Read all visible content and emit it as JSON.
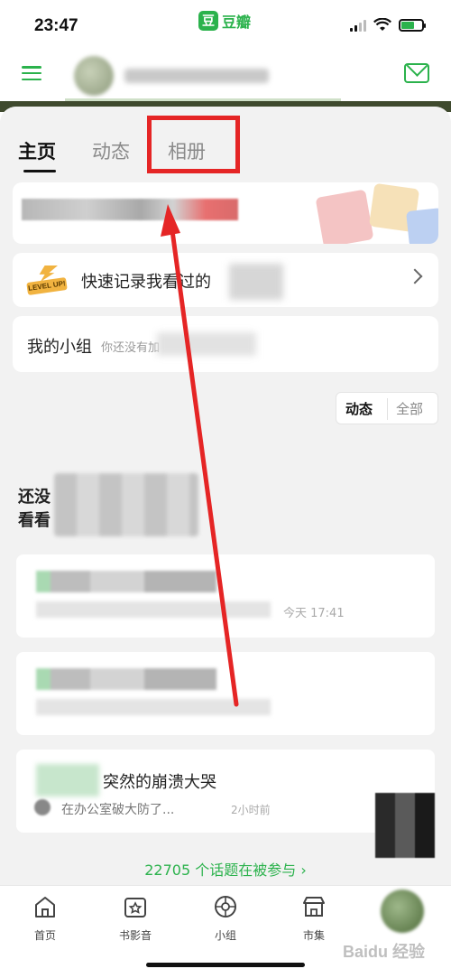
{
  "status_bar": {
    "time": "23:47",
    "app_badge_icon": "豆",
    "app_name": "豆瓣"
  },
  "header": {
    "left_icon": "hamburger-menu-icon",
    "right_icon": "mail-icon"
  },
  "tabs": [
    {
      "label": "主页",
      "active": true
    },
    {
      "label": "动态",
      "active": false
    },
    {
      "label": "相册",
      "active": false
    }
  ],
  "quick_record": {
    "badge_text": "LEVEL UP!",
    "label": "快速记录我看过的"
  },
  "my_groups": {
    "label": "我的小组",
    "sub": "你还没有加"
  },
  "filter": {
    "options": [
      "动态",
      "全部"
    ],
    "selected": "动态"
  },
  "empty_state": {
    "line1": "还没",
    "line2": "看看"
  },
  "topics": [
    {
      "time": "今天 17:41"
    },
    {},
    {
      "title": "突然的崩溃大哭",
      "excerpt": "在办公室破大防了...",
      "ago": "2小时前"
    }
  ],
  "topics_link": "22705 个话题在被参与 ›",
  "bottom_nav": [
    {
      "label": "首页",
      "icon": "home-icon"
    },
    {
      "label": "书影音",
      "icon": "books-movies-music-icon"
    },
    {
      "label": "小组",
      "icon": "groups-icon"
    },
    {
      "label": "市集",
      "icon": "market-icon"
    }
  ],
  "watermark": "Baidu 经验",
  "colors": {
    "accent": "#2bb24c",
    "highlight": "#e52525"
  }
}
